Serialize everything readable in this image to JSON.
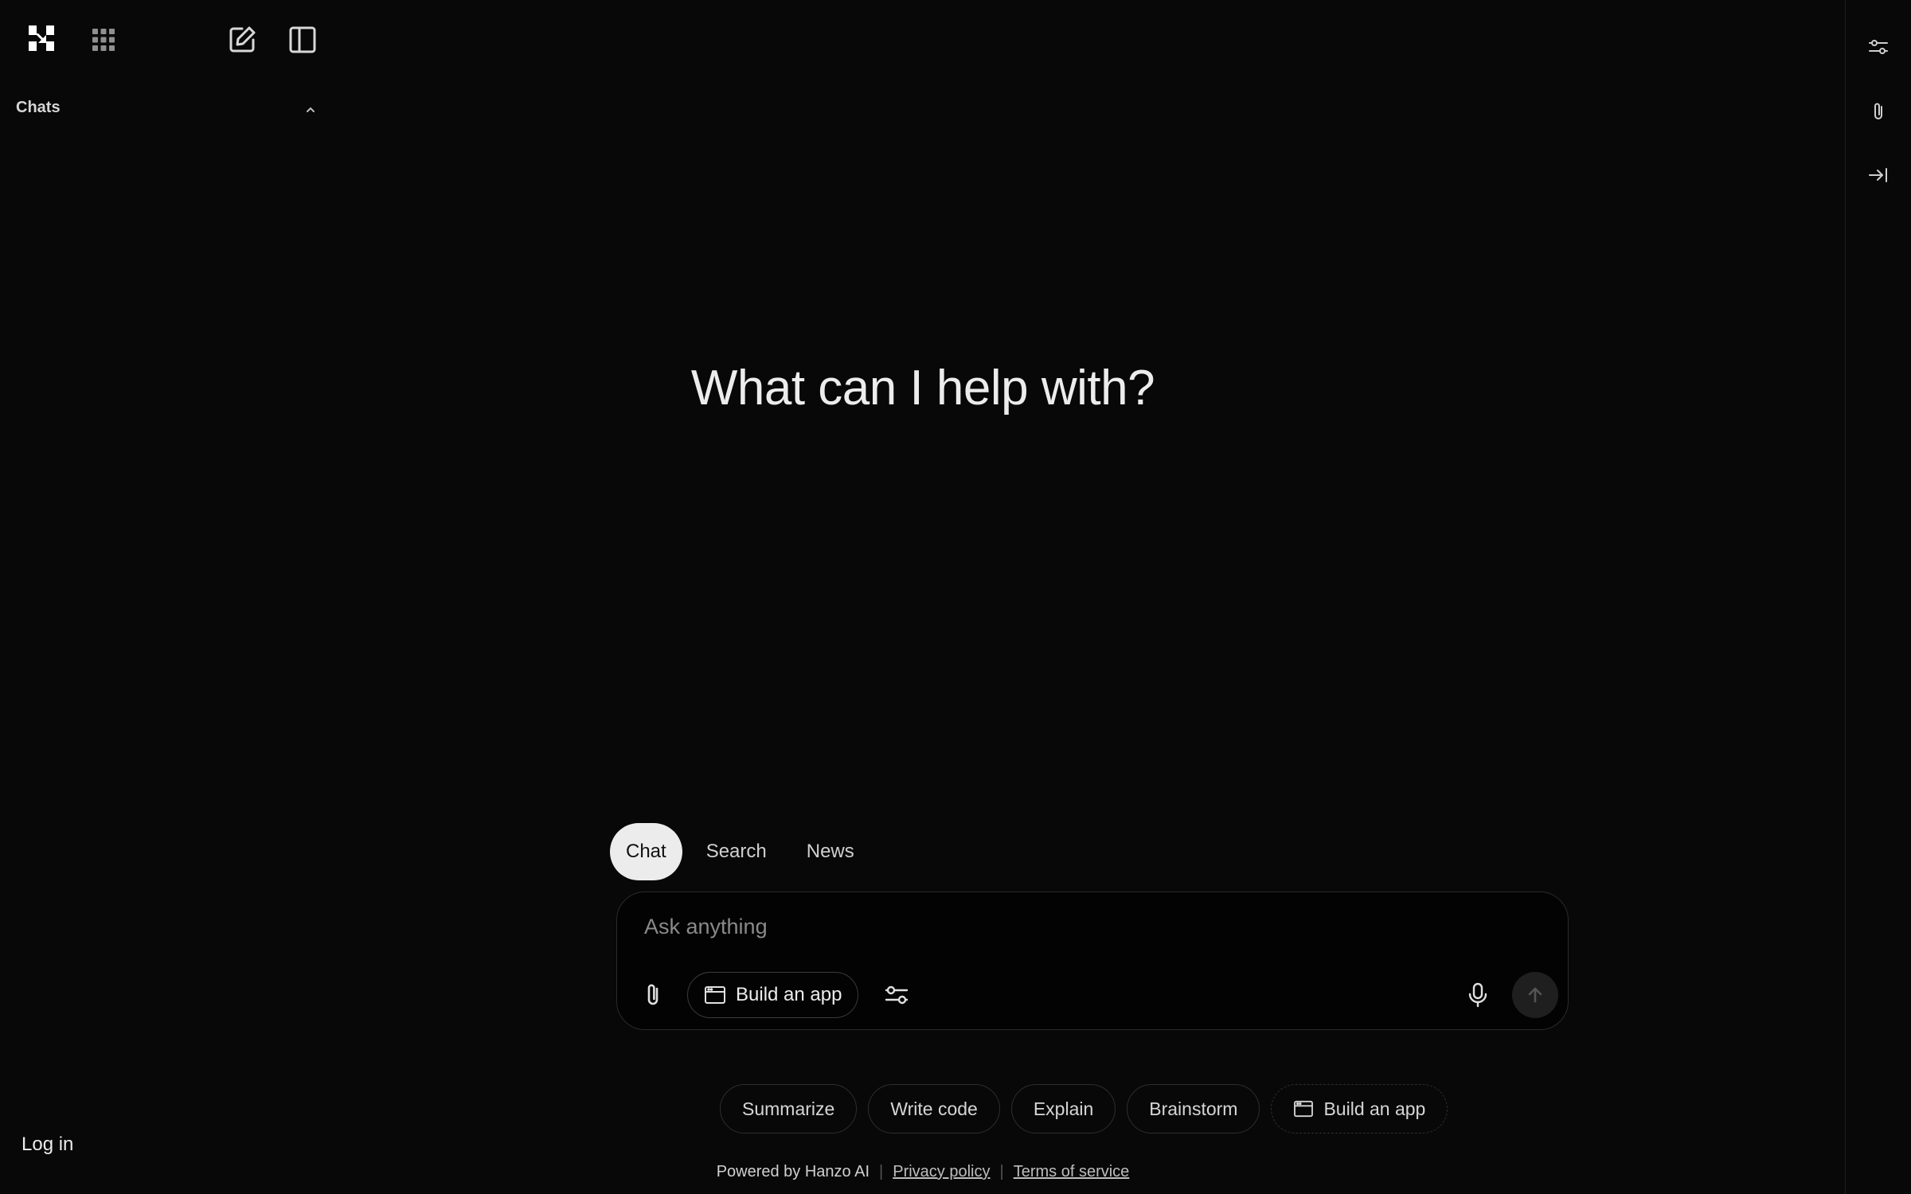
{
  "sidebar": {
    "chats_title": "Chats",
    "login_label": "Log in",
    "icons": [
      "logo-icon",
      "apps-grid-icon",
      "new-chat-icon",
      "sidebar-toggle-icon",
      "chevron-up-icon"
    ]
  },
  "right_rail": {
    "icons": [
      "settings-sliders-icon",
      "paperclip-icon",
      "collapse-right-icon"
    ]
  },
  "main": {
    "headline": "What can I help with?"
  },
  "mode_tabs": [
    {
      "label": "Chat",
      "active": true
    },
    {
      "label": "Search",
      "active": false
    },
    {
      "label": "News",
      "active": false
    }
  ],
  "composer": {
    "placeholder": "Ask anything",
    "value": "",
    "build_app_label": "Build an app"
  },
  "suggestions": [
    {
      "label": "Summarize"
    },
    {
      "label": "Write code"
    },
    {
      "label": "Explain"
    },
    {
      "label": "Brainstorm"
    },
    {
      "label": "Build an app"
    }
  ],
  "footer": {
    "powered_by": "Powered by Hanzo AI",
    "privacy": "Privacy policy",
    "terms": "Terms of service",
    "separator": "|"
  },
  "colors": {
    "background": "#080808",
    "text": "#ececec",
    "active_tab_bg": "#ececec",
    "border": "#2a2a2a"
  }
}
